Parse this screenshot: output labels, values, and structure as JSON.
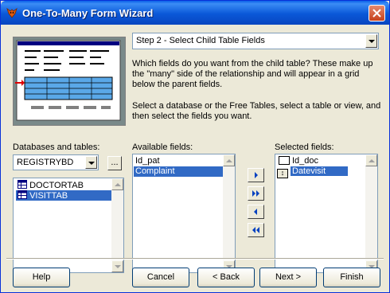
{
  "window": {
    "title": "One-To-Many Form Wizard"
  },
  "step_dropdown": {
    "value": "Step 2 - Select Child Table Fields"
  },
  "description": {
    "para1": "Which fields do you want from the child table? These make up the \"many\" side of the relationship and will appear in a grid below the parent fields.",
    "para2": "Select a database or the Free Tables, select a table or view, and then select the fields you want."
  },
  "databases": {
    "label": "Databases and tables:",
    "selected_db": "REGISTRYBD",
    "browse_label": "...",
    "tables": [
      {
        "name": "DOCTORTAB",
        "selected": false
      },
      {
        "name": "VISITTAB",
        "selected": true
      }
    ]
  },
  "available": {
    "label": "Available fields:",
    "items": [
      {
        "name": "Id_pat",
        "selected": false
      },
      {
        "name": "Complaint",
        "selected": true
      }
    ]
  },
  "selected": {
    "label": "Selected fields:",
    "items": [
      {
        "name": "Id_doc",
        "selected": false
      },
      {
        "name": "Datevisit",
        "selected": true
      }
    ]
  },
  "buttons": {
    "help": "Help",
    "cancel": "Cancel",
    "back": "< Back",
    "next": "Next >",
    "finish": "Finish"
  },
  "colors": {
    "title_bar": "#0a58d8",
    "selection": "#316ac5",
    "dialog_bg": "#ece9d8"
  }
}
